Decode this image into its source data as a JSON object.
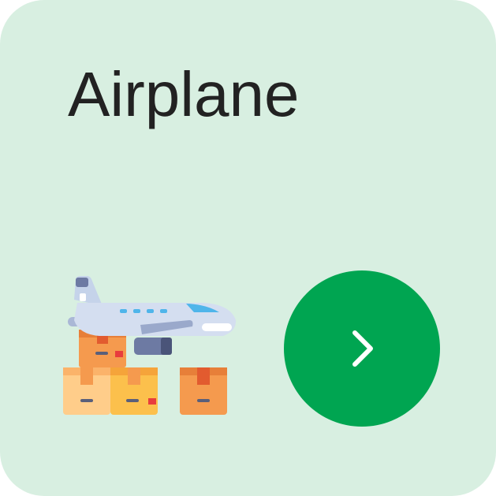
{
  "card": {
    "title": "Airplane",
    "background_color": "#d8efe1",
    "illustration_icon": "airplane-cargo-icon",
    "action_icon": "chevron-right-icon",
    "action_button_color": "#00a551"
  }
}
